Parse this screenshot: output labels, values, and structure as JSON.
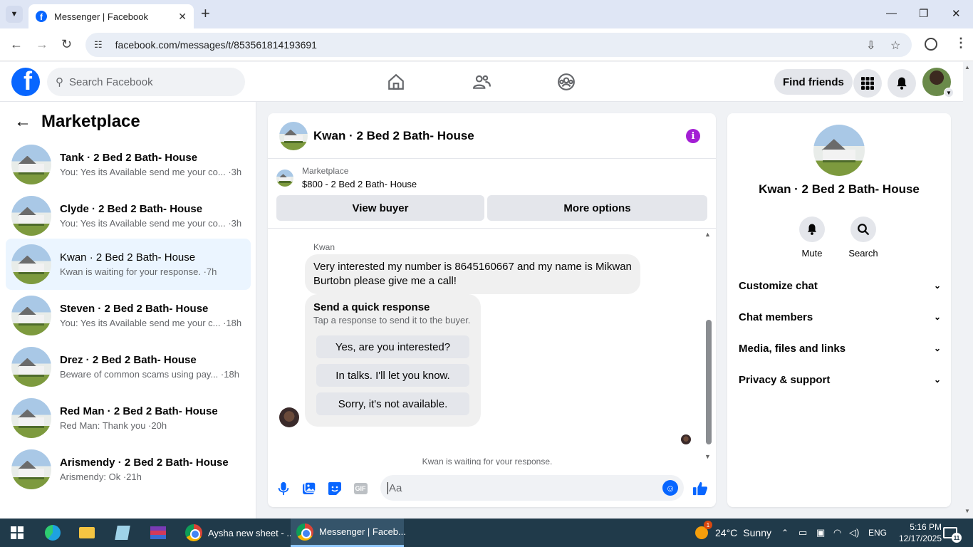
{
  "browser": {
    "tab_title": "Messenger | Facebook",
    "tab_close": "✕",
    "new_tab": "+",
    "url": "facebook.com/messages/t/853561814193691",
    "icons": [
      "tab-list-icon",
      "back-icon",
      "forward-icon",
      "reload-icon",
      "site-info-icon",
      "install-icon",
      "star-icon",
      "profile-icon",
      "menu-icon",
      "minimize-icon",
      "maximize-icon",
      "close-icon"
    ]
  },
  "fb": {
    "search_placeholder": "Search Facebook",
    "find_friends": "Find friends",
    "colors": {
      "brand": "#0866ff",
      "active_row": "#ebf5ff",
      "info_icon": "#a31ed4"
    }
  },
  "sidebar": {
    "title": "Marketplace",
    "conversations": [
      {
        "name": "Tank · 2 Bed 2 Bath- House",
        "preview": "You: Yes its Available send me your co... ·3h"
      },
      {
        "name": "Clyde · 2 Bed 2 Bath- House",
        "preview": "You: Yes its Available send me your co... ·3h"
      },
      {
        "name": "Kwan · 2 Bed 2 Bath- House",
        "preview": "Kwan is waiting for your response. ·7h"
      },
      {
        "name": "Steven · 2 Bed 2 Bath- House",
        "preview": "You: Yes its Available send me your c... ·18h"
      },
      {
        "name": "Drez · 2 Bed 2 Bath- House",
        "preview": "Beware of common scams using pay... ·18h"
      },
      {
        "name": "Red Man · 2 Bed 2 Bath- House",
        "preview": "Red Man: Thank you ·20h"
      },
      {
        "name": "Arismendy · 2 Bed 2 Bath- House",
        "preview": "Arismendy: Ok ·21h"
      }
    ]
  },
  "chat": {
    "title": "Kwan · 2 Bed 2 Bath- House",
    "listing_source": "Marketplace",
    "listing_price": "$800 - 2 Bed 2 Bath- House",
    "view_buyer": "View buyer",
    "more_options": "More options",
    "sender": "Kwan",
    "message": "Very interested my number is 8645160667 and my name is Mikwan Burtobn please give me a call!",
    "quick_title": "Send a quick response",
    "quick_subtitle": "Tap a response to send it to the buyer.",
    "quick_responses": [
      "Yes, are you interested?",
      "In talks. I'll let you know.",
      "Sorry, it's not available."
    ],
    "waiting_notice": "Kwan is waiting for your response.",
    "composer_placeholder": "Aa",
    "gif_label": "GIF"
  },
  "details": {
    "name": "Kwan · 2 Bed 2 Bath- House",
    "mute": "Mute",
    "search": "Search",
    "sections": [
      "Customize chat",
      "Chat members",
      "Media, files and links",
      "Privacy & support"
    ]
  },
  "taskbar": {
    "app1": "Aysha new sheet - ...",
    "app2": "Messenger | Faceb...",
    "weather_temp": "24°C",
    "weather_text": "Sunny",
    "lang": "ENG",
    "time": "5:16 PM",
    "date": "12/17/2025",
    "notif_count": "11",
    "weather_badge": "1"
  }
}
